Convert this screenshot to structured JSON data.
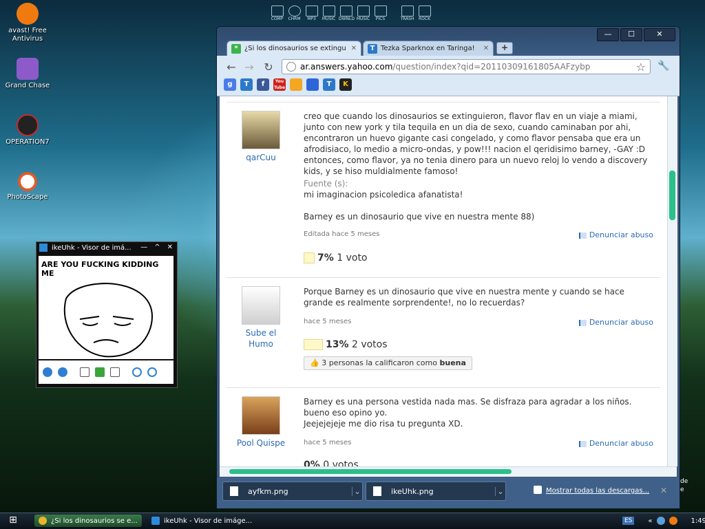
{
  "desktop": {
    "icons": [
      {
        "label": "avast! Free\nAntivirus",
        "color": "#f07a10"
      },
      {
        "label": "Grand Chase",
        "color": "#8c5bc9"
      },
      {
        "label": "OPERATION7",
        "color": "#c62a2a"
      },
      {
        "label": "PhotoScape",
        "color": "#e05a2a"
      }
    ],
    "dock": [
      "COMP",
      "CHRM",
      "MP3",
      "MUSIC",
      "DWNLD",
      "MUSIC",
      "PICS",
      "TRASH",
      "ROCK"
    ]
  },
  "chrome": {
    "tabs": [
      {
        "label": "¿Si los dinosaurios se extinguieron",
        "icon": "green-asterisk-icon",
        "color": "#3bb54a"
      },
      {
        "label": "Tezka Sparknox en Taringa!",
        "icon": "taringa-t-icon",
        "color": "#2c79c9"
      }
    ],
    "new_tab": "+",
    "window_buttons": {
      "minimize": "—",
      "maximize": "☐",
      "close": "✕"
    },
    "url_host": "ar.answers.yahoo.com",
    "url_path": "/question/index?qid=20110309161805AAFzybp",
    "bookmarks": [
      {
        "label": "g",
        "color": "#4a7de8"
      },
      {
        "label": "T",
        "color": "#2c79c9"
      },
      {
        "label": "f",
        "color": "#3b5998"
      },
      {
        "label": "You Tube",
        "color": "#d0211a"
      },
      {
        "label": "",
        "color": "#f5a623"
      },
      {
        "label": "",
        "color": "#2e66d8"
      },
      {
        "label": "T",
        "color": "#2c79c9"
      },
      {
        "label": "K",
        "color": "#222222"
      }
    ]
  },
  "answers": [
    {
      "user": "qarCuu",
      "text": "creo que cuando los dinosaurios se extinguieron, flavor flav en un viaje a miami, junto con new york y tila tequila en un dia de sexo, cuando caminaban por ahi, encontraron un huevo gigante casi congelado, y como flavor pensaba que era un afrodisiaco, lo medio a micro-ondas, y pow!!! nacion el qeridisimo barney, -GAY :D\nentonces, como flavor, ya no tenia dinero para un nuevo reloj lo vendo a discovery kids, y se hiso muldialmente famoso!",
      "source_label": "Fuente (s):",
      "source": "mi imaginacion psicoledica afanatista!",
      "extra": "Barney es un dinosaurio que vive en nuestra mente 88)",
      "meta": "Editada hace 5 meses",
      "report": "Denunciar abuso",
      "percent": "7%",
      "votes": "1 voto"
    },
    {
      "user": "Sube el Humo",
      "text": "Porque Barney es un dinosaurio que vive en nuestra mente y cuando se hace grande es realmente sorprendente!, no lo recuerdas?",
      "meta": "hace 5 meses",
      "report": "Denunciar abuso",
      "percent": "13%",
      "votes": "2 votos",
      "rated_prefix": "3 personas la calificaron como ",
      "rated_bold": "buena"
    },
    {
      "user": "Pool Quispe",
      "text": "Barney es una persona vestida nada mas. Se disfraza para agradar a los niños. bueno eso opino yo.\nJeejejejeje me dio risa tu pregunta XD.",
      "meta": "hace 5 meses",
      "report": "Denunciar abuso",
      "percent": "0%",
      "votes": "0 votos"
    }
  ],
  "downloads": {
    "items": [
      "ayfkm.png",
      "ikeUhk.png"
    ],
    "show_all": "Mostrar todas las descargas...",
    "close": "✕"
  },
  "viewer": {
    "title": "ikeUhk - Visor de imá...",
    "meme_text": "ARE YOU FUCKING KIDDING ME"
  },
  "taskbar": {
    "tasks": [
      "¿Si los dinosaurios se e...",
      "ikeUhk - Visor de imáge..."
    ],
    "lang": "ES",
    "clock": "1:49",
    "side_text": "de\ne"
  }
}
